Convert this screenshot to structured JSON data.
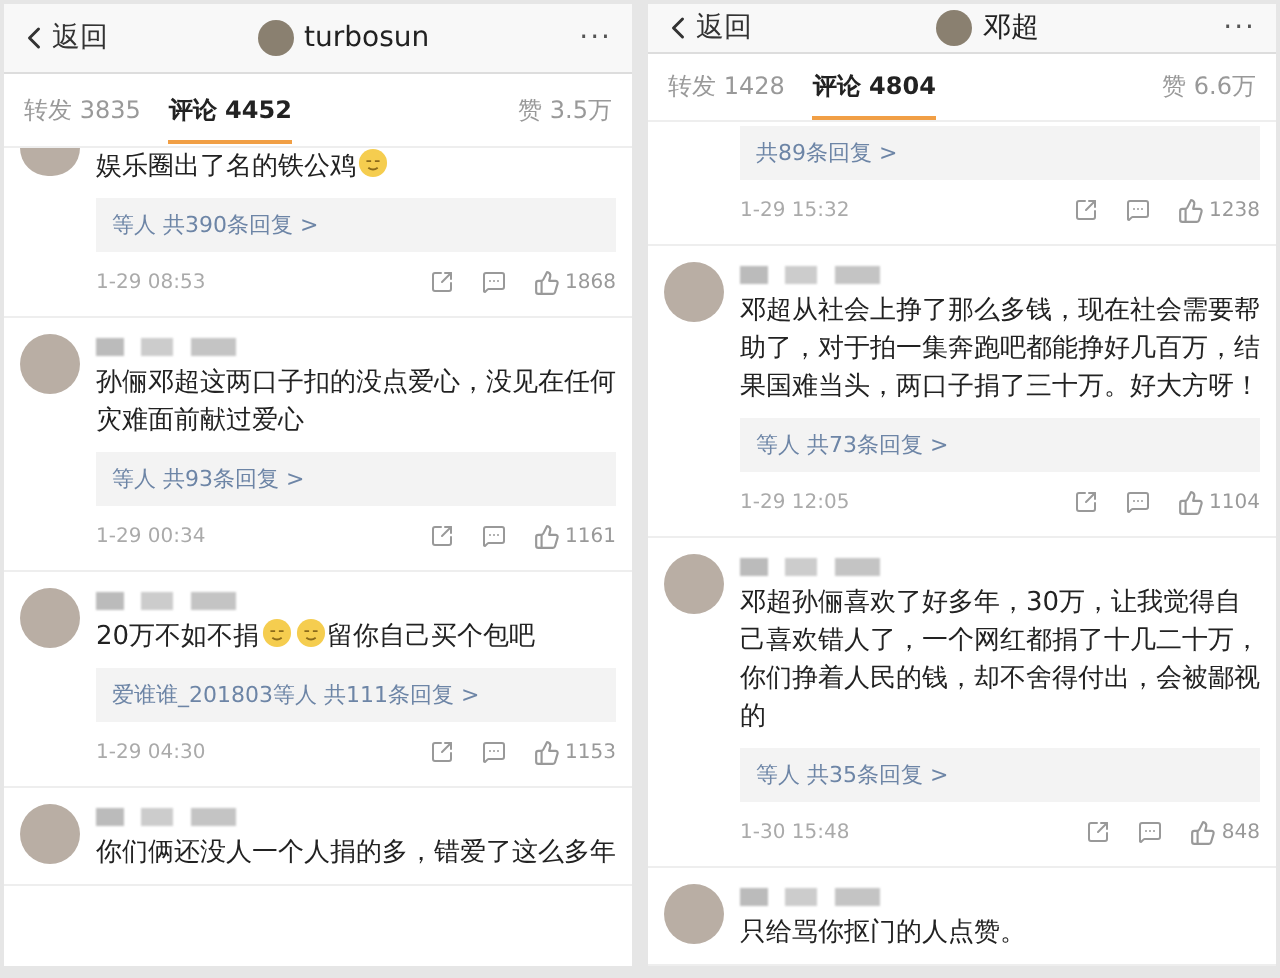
{
  "panels": [
    {
      "back": "返回",
      "title": "turbosun",
      "more": "···",
      "tabs": [
        {
          "label": "转发 3835",
          "selected": false
        },
        {
          "label": "评论 4452",
          "selected": true
        }
      ],
      "likes_tab": "赞 3.5万",
      "comments": [
        {
          "cut_top": true,
          "author_hidden": false,
          "avatar": true,
          "segments": [
            {
              "kind": "text",
              "text": "娱乐圈出了名的铁公鸡"
            },
            {
              "kind": "emoji"
            }
          ],
          "replies": "等人 共390条回复 >",
          "time": "1-29 08:53",
          "likes": "1868"
        },
        {
          "cut_top": false,
          "author_hidden": true,
          "avatar": true,
          "segments": [
            {
              "kind": "text",
              "text": "孙俪邓超这两口子扣的没点爱心，没见在任何灾难面前献过爱心"
            }
          ],
          "replies": "等人 共93条回复 >",
          "time": "1-29 00:34",
          "likes": "1161"
        },
        {
          "cut_top": false,
          "author_hidden": true,
          "avatar": true,
          "segments": [
            {
              "kind": "text",
              "text": "20万不如不捐"
            },
            {
              "kind": "emoji"
            },
            {
              "kind": "emoji"
            },
            {
              "kind": "text",
              "text": "留你自己买个包吧"
            }
          ],
          "replies": "爱谁谁_201803等人 共111条回复 >",
          "time": "1-29 04:30",
          "likes": "1153"
        },
        {
          "cut_top": false,
          "author_hidden": true,
          "avatar": true,
          "segments": [
            {
              "kind": "text",
              "text": "你们俩还没人一个人捐的多，错爱了这么多年"
            }
          ]
        }
      ]
    },
    {
      "back": "返回",
      "title": "邓超",
      "more": "···",
      "tabs": [
        {
          "label": "转发 1428",
          "selected": false
        },
        {
          "label": "评论 4804",
          "selected": true
        }
      ],
      "likes_tab": "赞 6.6万",
      "comments": [
        {
          "cut_top": true,
          "author_hidden": false,
          "avatar": false,
          "replies": "共89条回复 >",
          "time": "1-29 15:32",
          "likes": "1238"
        },
        {
          "cut_top": false,
          "author_hidden": true,
          "avatar": true,
          "segments": [
            {
              "kind": "text",
              "text": "邓超从社会上挣了那么多钱，现在社会需要帮助了，对于拍一集奔跑吧都能挣好几百万，结果国难当头，两口子捐了三十万。好大方呀！"
            }
          ],
          "replies": "等人 共73条回复 >",
          "time": "1-29 12:05",
          "likes": "1104"
        },
        {
          "cut_top": false,
          "author_hidden": true,
          "avatar": true,
          "segments": [
            {
              "kind": "text",
              "text": "邓超孙俪喜欢了好多年，30万，让我觉得自己喜欢错人了，一个网红都捐了十几二十万，你们挣着人民的钱，却不舍得付出，会被鄙视的"
            }
          ],
          "replies": "等人 共35条回复 >",
          "time": "1-30 15:48",
          "likes": "848"
        },
        {
          "cut_top": false,
          "author_hidden": true,
          "avatar": true,
          "segments": [
            {
              "kind": "text",
              "text": "只给骂你抠门的人点赞。"
            }
          ]
        }
      ]
    }
  ]
}
